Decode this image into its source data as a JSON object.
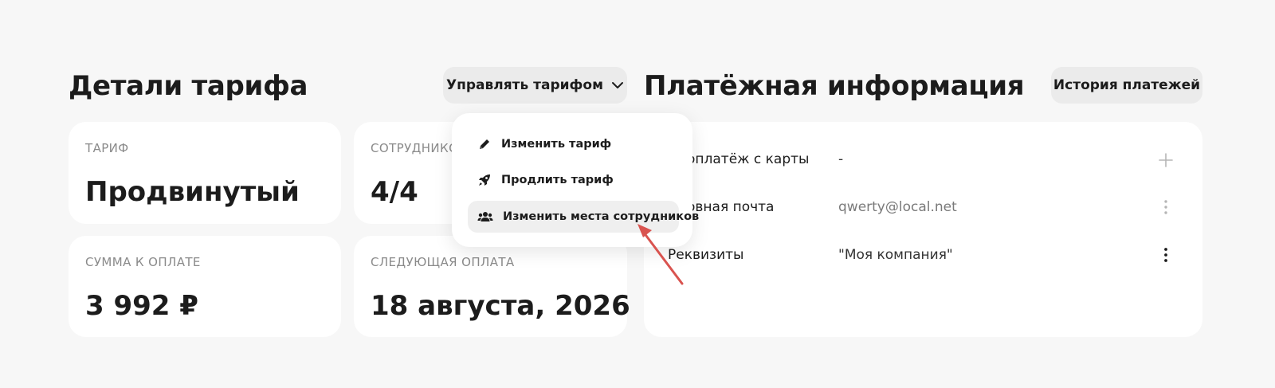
{
  "tariff_details": {
    "title": "Детали тарифа",
    "manage_button": "Управлять тарифом",
    "cards": [
      {
        "label": "ТАРИФ",
        "value": "Продвинутый"
      },
      {
        "label": "СОТРУДНИКО",
        "value": "4/4"
      },
      {
        "label": "СУММА К ОПЛАТЕ",
        "value": "3 992 ₽"
      },
      {
        "label": "СЛЕДУЮЩАЯ ОПЛАТА",
        "value": "18 августа, 2026"
      }
    ]
  },
  "manage_menu": {
    "items": [
      {
        "label": "Изменить тариф",
        "icon": "pencil-icon"
      },
      {
        "label": "Продлить тариф",
        "icon": "rocket-icon"
      },
      {
        "label": "Изменить места сотрудников",
        "icon": "users-icon",
        "active": true
      }
    ]
  },
  "payment_info": {
    "title": "Платёжная информация",
    "history_button": "История платежей",
    "rows": [
      {
        "label": "оплатёж с карты",
        "value": "-",
        "action_icon": "plus-icon"
      },
      {
        "label": "овная почта",
        "value": "qwerty@local.net",
        "action_icon": "more-vertical-icon"
      },
      {
        "label": "Реквизиты",
        "value": "\"Моя компания\"",
        "action_icon": "more-vertical-icon"
      }
    ]
  },
  "colors": {
    "page_background": "#f7f7f7",
    "card_background": "#ffffff",
    "button_background": "#ebebeb",
    "annotation_arrow": "#d9534f"
  }
}
